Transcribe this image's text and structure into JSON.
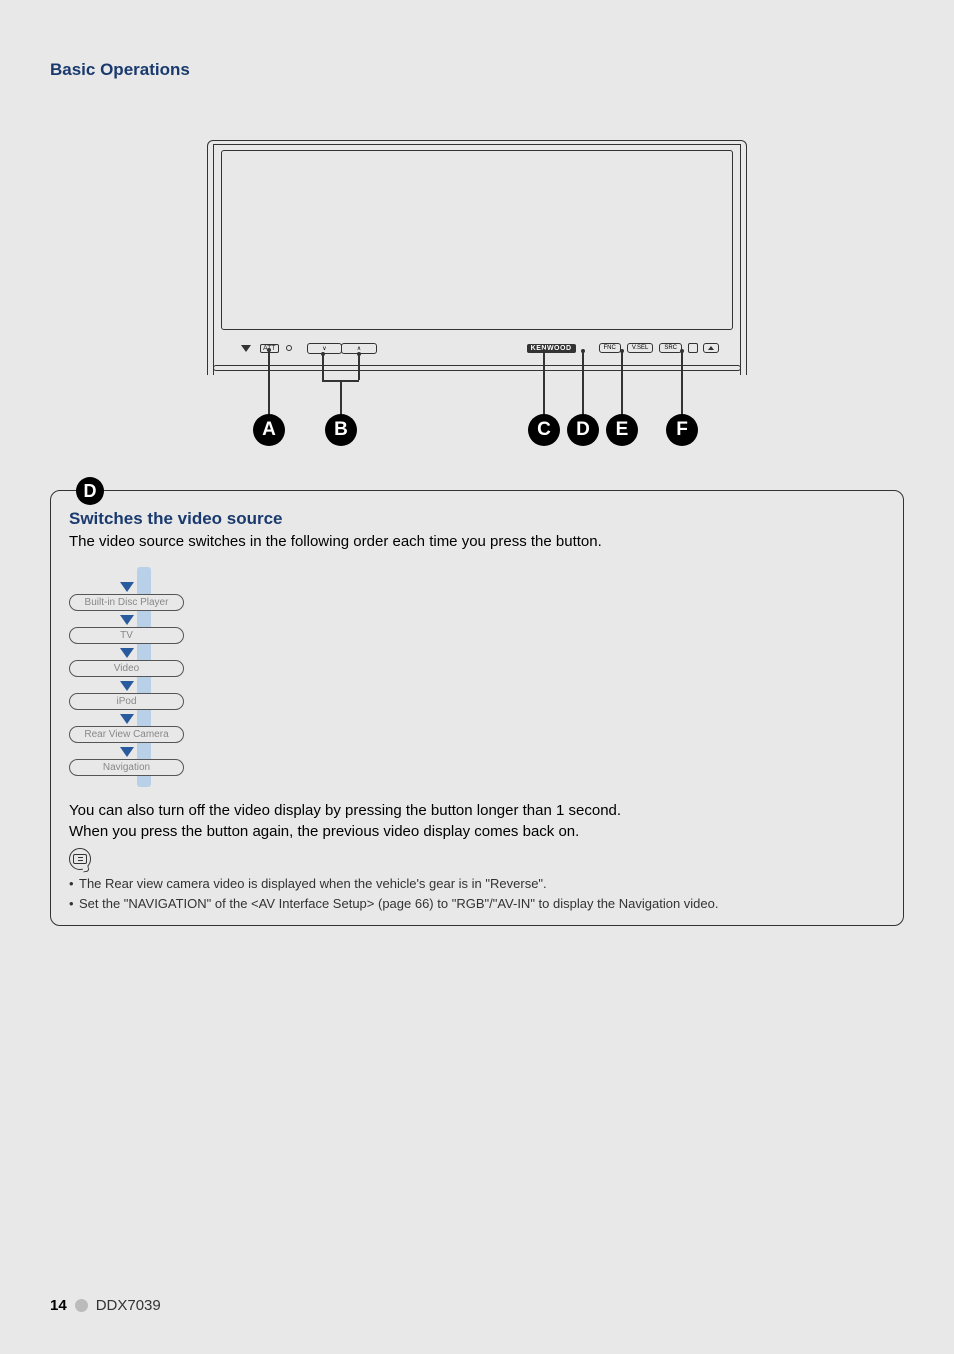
{
  "header": {
    "section_title": "Basic Operations"
  },
  "device": {
    "panel": {
      "att_label": "ATT",
      "logo": "KENWOOD",
      "fnc_label": "FNC",
      "vsel_label": "V.SEL",
      "src_label": "SRC"
    },
    "callouts": {
      "a": "A",
      "b": "B",
      "c": "C",
      "d": "D",
      "e": "E",
      "f": "F"
    }
  },
  "section_d": {
    "badge": "D",
    "title": "Switches the video source",
    "intro": "The video source switches in the following order each time you press the button.",
    "flow": [
      "Built-in Disc Player",
      "TV",
      "Video",
      "iPod",
      "Rear View Camera",
      "Navigation"
    ],
    "body1": "You can also turn off the video display by pressing the button longer than 1 second.",
    "body2": "When you press the button again, the previous video display comes back on.",
    "notes": [
      "The Rear view camera video is displayed when the vehicle's gear is in \"Reverse\".",
      "Set the \"NAVIGATION\" of the <AV Interface Setup> (page 66) to \"RGB\"/\"AV-IN\" to display the Navigation video."
    ]
  },
  "footer": {
    "page_number": "14",
    "model": "DDX7039"
  }
}
